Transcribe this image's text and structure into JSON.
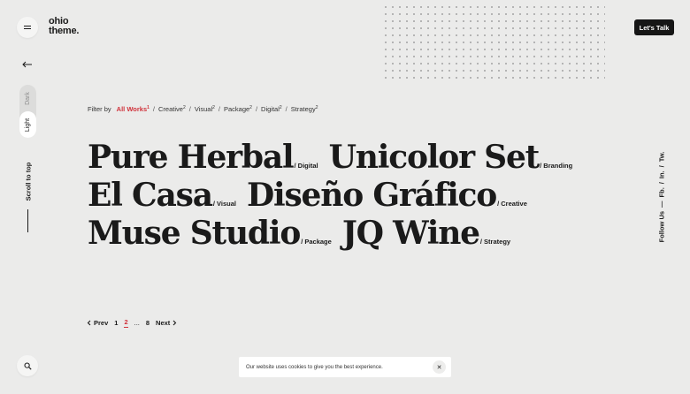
{
  "header": {
    "logo_line1": "ohio",
    "logo_line2": "theme.",
    "cta_label": "Let's Talk"
  },
  "sidebar": {
    "mode_dark": "Dark",
    "mode_light": "Light",
    "scroll_top": "Scroll to top"
  },
  "filter": {
    "label": "Filter by",
    "items": [
      {
        "label": "All Works",
        "count": "1",
        "active": true
      },
      {
        "label": "Creative",
        "count": "2"
      },
      {
        "label": "Visual",
        "count": "2"
      },
      {
        "label": "Package",
        "count": "2"
      },
      {
        "label": "Digital",
        "count": "2"
      },
      {
        "label": "Strategy",
        "count": "2"
      }
    ],
    "separator": "/"
  },
  "projects": [
    {
      "title": "Pure Herbal",
      "category": "/ Digital"
    },
    {
      "title": "Unicolor Set",
      "category": "/ Branding"
    },
    {
      "title": "El Casa",
      "category": "/ Visual"
    },
    {
      "title": "Diseño Gráfico",
      "category": "/ Creative"
    },
    {
      "title": "Muse Studio",
      "category": "/ Package"
    },
    {
      "title": "JQ Wine",
      "category": "/ Strategy"
    }
  ],
  "pagination": {
    "prev": "Prev",
    "pages": [
      "1",
      "2",
      "...",
      "8"
    ],
    "current": "2",
    "next": "Next"
  },
  "social": {
    "label": "Follow Us",
    "dash": "—",
    "links": [
      "Fb.",
      "/",
      "In.",
      "/",
      "Tw."
    ]
  },
  "cookie": {
    "text": "Our website uses cookies to give you the best experience.",
    "close": "✕"
  },
  "colors": {
    "background": "#ebebea",
    "accent": "#d0313a",
    "dark": "#161616"
  },
  "icons": {
    "menu": "hamburger-icon",
    "back": "arrow-left-icon",
    "search": "search-icon"
  }
}
